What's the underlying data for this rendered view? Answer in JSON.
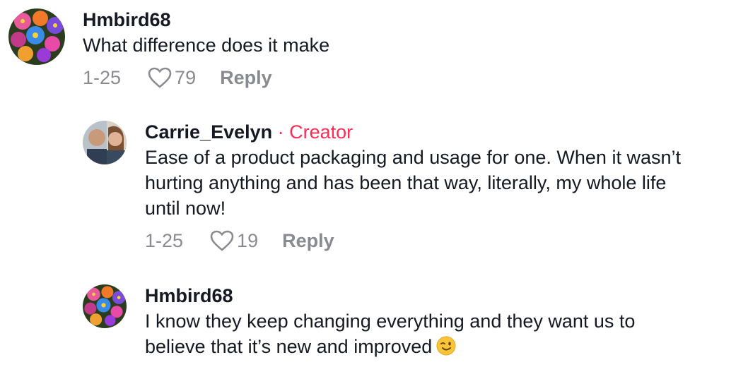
{
  "comments": [
    {
      "username": "Hmbird68",
      "text": "What difference does it make",
      "date": "1-25",
      "likes": "79",
      "reply_label": "Reply"
    },
    {
      "username": "Carrie_Evelyn",
      "badge": "· Creator",
      "text_line1": "Ease of a product packaging and usage for one. When it wasn’t",
      "text_line2": "hurting anything and has been that way, literally, my whole life",
      "text_line3": "until now!",
      "date": "1-25",
      "likes": "19",
      "reply_label": "Reply"
    },
    {
      "username": "Hmbird68",
      "text_line1": "I know they keep changing everything and they want us to",
      "text_line2": "believe that it’s new and improved",
      "emoji": "winking-face"
    }
  ],
  "colors": {
    "creator_badge": "#fe2c55",
    "meta_gray": "#8a8b91",
    "text": "#161823"
  },
  "icons": {
    "like": "heart-outline-icon"
  }
}
